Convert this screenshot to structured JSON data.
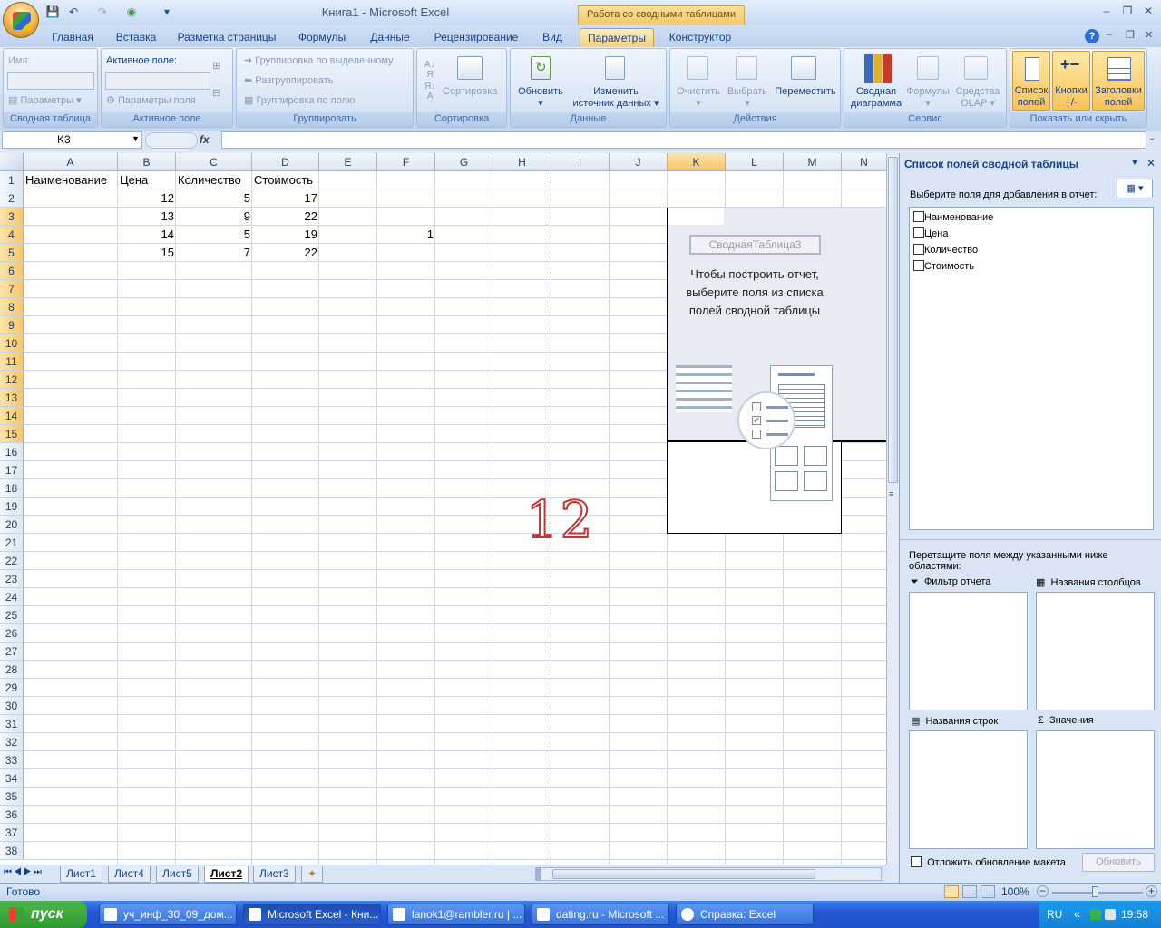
{
  "window": {
    "title": "Книга1 - Microsoft Excel",
    "context_header": "Работа со сводными таблицами"
  },
  "tabs": [
    "Главная",
    "Вставка",
    "Разметка страницы",
    "Формулы",
    "Данные",
    "Рецензирование",
    "Вид",
    "Параметры",
    "Конструктор"
  ],
  "ribbon": {
    "g1": {
      "name_label": "Имя:",
      "params": "Параметры",
      "label": "Сводная таблица"
    },
    "g2": {
      "field_label": "Активное поле:",
      "field_params": "Параметры поля",
      "label": "Активное поле"
    },
    "g3": {
      "group_sel": "Группировка по выделенному",
      "ungroup": "Разгруппировать",
      "group_field": "Группировка по полю",
      "label": "Группировать"
    },
    "g4": {
      "sort": "Сортировка",
      "label": "Сортировка"
    },
    "g5": {
      "refresh": "Обновить",
      "change_src_1": "Изменить",
      "change_src_2": "источник данных",
      "label": "Данные"
    },
    "g6": {
      "clear": "Очистить",
      "select": "Выбрать",
      "move": "Переместить",
      "label": "Действия"
    },
    "g7": {
      "chart_1": "Сводная",
      "chart_2": "диаграмма",
      "formulas": "Формулы",
      "olap_1": "Средства",
      "olap_2": "OLAP",
      "label": "Сервис"
    },
    "g8": {
      "fields_1": "Список",
      "fields_2": "полей",
      "buttons_1": "Кнопки",
      "buttons_2": "+/-",
      "headers_1": "Заголовки",
      "headers_2": "полей",
      "label": "Показать или скрыть"
    }
  },
  "formula_bar": {
    "name_box": "K3",
    "fx": "fx",
    "value": ""
  },
  "columns": [
    "A",
    "B",
    "C",
    "D",
    "E",
    "F",
    "G",
    "H",
    "I",
    "J",
    "K",
    "L",
    "M",
    "N"
  ],
  "rows": [
    "1",
    "2",
    "3",
    "4",
    "5",
    "6",
    "7",
    "8",
    "9",
    "10",
    "11",
    "12",
    "13",
    "14",
    "15",
    "16",
    "17",
    "18",
    "19",
    "20",
    "21",
    "22",
    "23",
    "24",
    "25",
    "26",
    "27",
    "28",
    "29",
    "30",
    "31",
    "32",
    "33",
    "34",
    "35",
    "36",
    "37",
    "38"
  ],
  "cells": {
    "A1": "Наименование",
    "B1": "Цена",
    "C1": "Количество",
    "D1": "Стоимость",
    "B2": "12",
    "C2": "5",
    "D2": "17",
    "B3": "13",
    "C3": "9",
    "D3": "22",
    "B4": "14",
    "C4": "5",
    "D4": "19",
    "F4": "1",
    "B5": "15",
    "C5": "7",
    "D5": "22"
  },
  "pivot": {
    "name": "СводнаяТаблица3",
    "message_1": "Чтобы построить отчет,",
    "message_2": "выберите поля из списка",
    "message_3": "полей сводной таблицы"
  },
  "watermark": "12",
  "sheets": [
    "Лист1",
    "Лист4",
    "Лист5",
    "Лист2",
    "Лист3"
  ],
  "pane": {
    "title": "Список полей сводной таблицы",
    "choose": "Выберите поля для добавления в отчет:",
    "fields": [
      "Наименование",
      "Цена",
      "Количество",
      "Стоимость"
    ],
    "drag": "Перетащите поля между указанными ниже областями:",
    "filter": "Фильтр отчета",
    "cols": "Названия столбцов",
    "rows": "Названия строк",
    "values": "Значения",
    "defer": "Отложить обновление макета",
    "update": "Обновить"
  },
  "status": {
    "ready": "Готово",
    "zoom": "100%"
  },
  "taskbar": {
    "start": "пуск",
    "tasks": [
      "уч_инф_30_09_дом...",
      "Microsoft Excel - Кни...",
      "lanok1@rambler.ru | ...",
      "dating.ru - Microsoft ...",
      "Справка: Excel"
    ],
    "lang": "RU",
    "time": "19:58"
  }
}
